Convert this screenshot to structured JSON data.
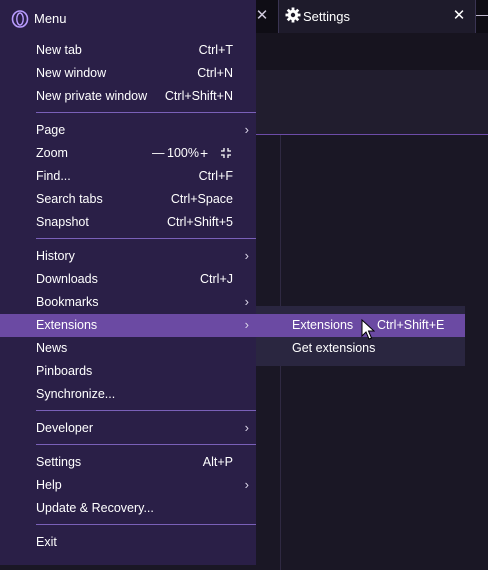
{
  "tabs": {
    "previous_close": "✕",
    "active": {
      "label": "Settings",
      "icon": "gear-icon",
      "close": "✕"
    }
  },
  "menu": {
    "title": "Menu",
    "logo_icon": "opera-logo-icon",
    "items": [
      {
        "label": "New tab",
        "shortcut": "Ctrl+T"
      },
      {
        "label": "New window",
        "shortcut": "Ctrl+N"
      },
      {
        "label": "New private window",
        "shortcut": "Ctrl+Shift+N"
      },
      {
        "label": "Page",
        "shortcut": "",
        "submenu": true
      },
      {
        "label": "Zoom",
        "shortcut": ""
      },
      {
        "label": "Find...",
        "shortcut": "Ctrl+F"
      },
      {
        "label": "Search tabs",
        "shortcut": "Ctrl+Space"
      },
      {
        "label": "Snapshot",
        "shortcut": "Ctrl+Shift+5"
      },
      {
        "label": "History",
        "shortcut": "",
        "submenu": true
      },
      {
        "label": "Downloads",
        "shortcut": "Ctrl+J"
      },
      {
        "label": "Bookmarks",
        "shortcut": "",
        "submenu": true
      },
      {
        "label": "Extensions",
        "shortcut": "",
        "submenu": true,
        "active": true
      },
      {
        "label": "News",
        "shortcut": ""
      },
      {
        "label": "Pinboards",
        "shortcut": ""
      },
      {
        "label": "Synchronize...",
        "shortcut": ""
      },
      {
        "label": "Developer",
        "shortcut": "",
        "submenu": true
      },
      {
        "label": "Settings",
        "shortcut": "Alt+P"
      },
      {
        "label": "Help",
        "shortcut": "",
        "submenu": true
      },
      {
        "label": "Update & Recovery...",
        "shortcut": ""
      },
      {
        "label": "Exit",
        "shortcut": ""
      }
    ],
    "submenu_arrow": "›",
    "zoom": {
      "minus": "—",
      "value": "100%",
      "plus": "+",
      "fullscreen_icon": "fullscreen-icon"
    }
  },
  "extensions_submenu": {
    "items": [
      {
        "label": "Extensions",
        "shortcut": "Ctrl+Shift+E",
        "active": true
      },
      {
        "label": "Get extensions",
        "shortcut": ""
      }
    ]
  },
  "colors": {
    "menu_bg": "#2a1f47",
    "highlight": "#6b4aa3",
    "separator": "#7a60b8",
    "submenu_bg": "#2a2640"
  }
}
